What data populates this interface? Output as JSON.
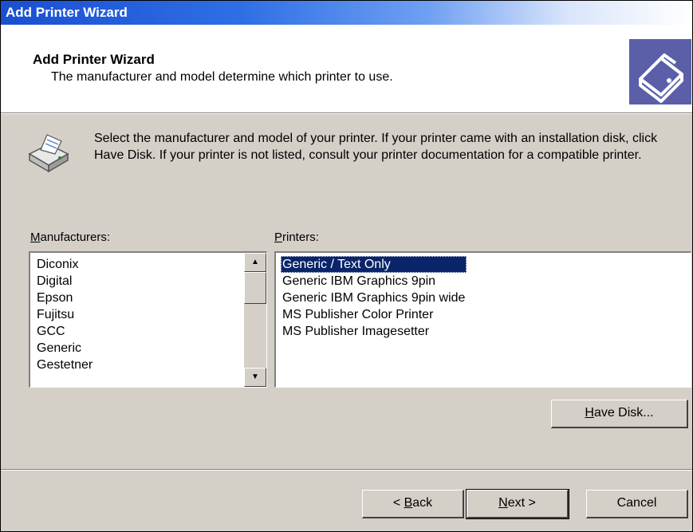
{
  "window": {
    "title": "Add Printer Wizard"
  },
  "header": {
    "title": "Add Printer Wizard",
    "subtitle": "The manufacturer and model determine which printer to use.",
    "icon": "printer-wizard-icon"
  },
  "intro": {
    "icon": "printer-icon",
    "text": "Select the manufacturer and model of your printer. If your printer came with an installation disk, click Have Disk. If your printer is not listed, consult your printer documentation for a compatible printer."
  },
  "manufacturers": {
    "label_accel": "M",
    "label_rest": "anufacturers:",
    "items": [
      "Diconix",
      "Digital",
      "Epson",
      "Fujitsu",
      "GCC",
      "Generic",
      "Gestetner"
    ]
  },
  "printers": {
    "label_accel": "P",
    "label_rest": "rinters:",
    "items": [
      "Generic / Text Only",
      "Generic IBM Graphics 9pin",
      "Generic IBM Graphics 9pin wide",
      "MS Publisher Color Printer",
      "MS Publisher Imagesetter"
    ],
    "selected": "Generic / Text Only"
  },
  "buttons": {
    "have_disk_accel": "H",
    "have_disk_rest": "ave Disk...",
    "back_prefix": "< ",
    "back_accel": "B",
    "back_rest": "ack",
    "next_accel": "N",
    "next_rest": "ext >",
    "cancel": "Cancel"
  },
  "colors": {
    "title_bar": "#1a4fd0",
    "selection": "#0a246a",
    "dialog_face": "#d4d0c8"
  }
}
